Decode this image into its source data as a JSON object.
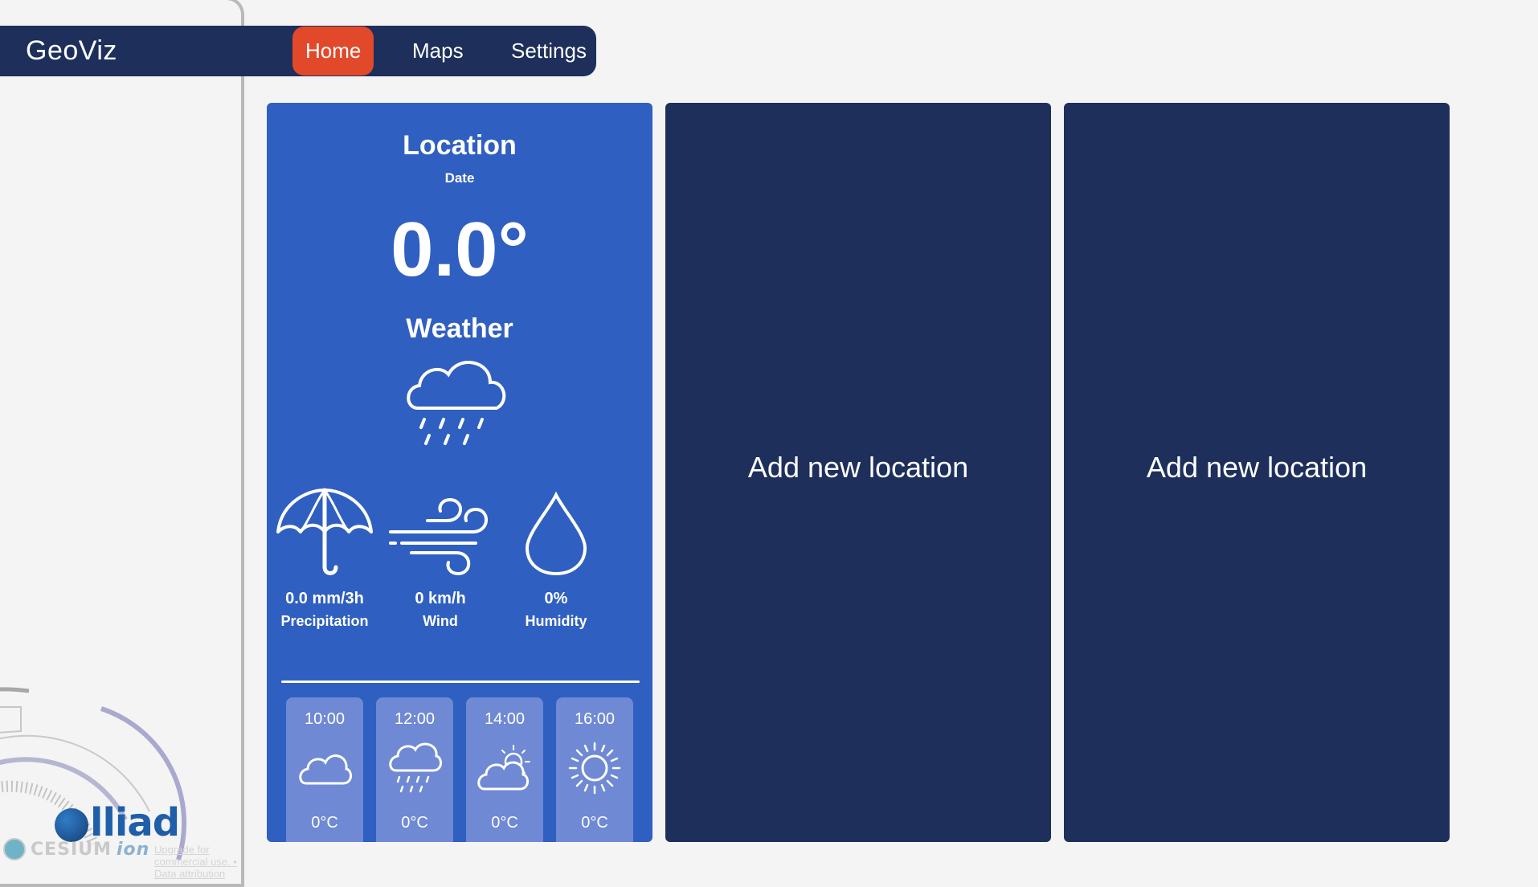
{
  "nav": {
    "logo": "GeoViz",
    "items": [
      {
        "label": "Home",
        "active": true
      },
      {
        "label": "Maps",
        "active": false
      },
      {
        "label": "Settings",
        "active": false
      }
    ]
  },
  "colors": {
    "nav_bg": "#1d2f5a",
    "active_tab": "#e2492a",
    "main_card": "#2f5fc0",
    "empty_card": "#1d2f5a",
    "forecast_tile": "#6f89d4"
  },
  "weather_card": {
    "location": "Location",
    "date": "Date",
    "temperature": "0.0°",
    "condition": "Weather",
    "condition_icon": "rain-cloud-icon",
    "stats": [
      {
        "value": "0.0 mm/3h",
        "label": "Precipitation",
        "icon": "umbrella-icon"
      },
      {
        "value": "0 km/h",
        "label": "Wind",
        "icon": "wind-icon"
      },
      {
        "value": "0%",
        "label": "Humidity",
        "icon": "droplet-icon"
      }
    ],
    "forecast": [
      {
        "time": "10:00",
        "temp": "0°C",
        "icon": "cloud-icon"
      },
      {
        "time": "12:00",
        "temp": "0°C",
        "icon": "rain-cloud-icon"
      },
      {
        "time": "14:00",
        "temp": "0°C",
        "icon": "partly-sunny-icon"
      },
      {
        "time": "16:00",
        "temp": "0°C",
        "icon": "sun-icon"
      }
    ]
  },
  "empty_cards": [
    {
      "label": "Add new location"
    },
    {
      "label": "Add new location"
    }
  ],
  "globe_panel": {
    "brand": "lliad",
    "credit_name": "CESIUM",
    "credit_suffix": "ion",
    "credit_links": "Upgrade for commercial use. • Data attribution"
  }
}
